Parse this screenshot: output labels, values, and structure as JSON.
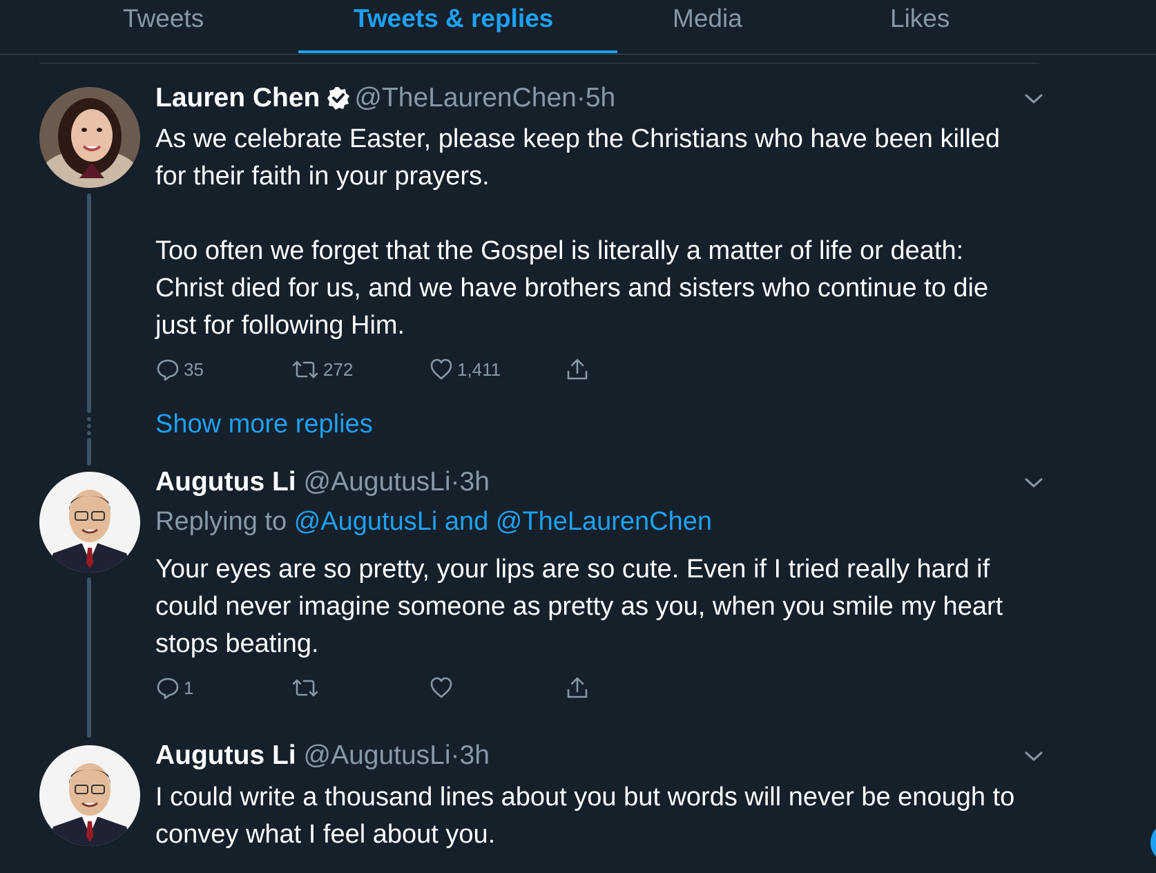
{
  "tabs": [
    {
      "label": "Tweets"
    },
    {
      "label": "Tweets & replies"
    },
    {
      "label": "Media"
    },
    {
      "label": "Likes"
    }
  ],
  "active_tab": "Tweets & replies",
  "show_more_label": "Show more replies",
  "tweets": [
    {
      "name": "Lauren Chen",
      "verified": true,
      "handle": "@TheLaurenChen",
      "separator": "·",
      "time": "5h",
      "paragraphs": [
        "As we celebrate Easter, please keep the Christians who have been killed for their faith in your prayers.",
        "Too often we forget that the Gospel is literally a matter of life or death: Christ died for us, and we have brothers and sisters who continue to die just for following Him."
      ],
      "replies": "35",
      "retweets": "272",
      "likes": "1,411"
    },
    {
      "name": "Augutus Li",
      "handle": "@AugutusLi",
      "separator": "·",
      "time": "3h",
      "replying_prefix": "Replying to",
      "replying_to": "@AugutusLi and @TheLaurenChen",
      "paragraphs": [
        "Your eyes are so pretty, your lips are so cute. Even if I tried really hard if could never imagine someone as pretty as you, when you smile my heart stops beating."
      ],
      "replies": "1",
      "retweets": "",
      "likes": ""
    },
    {
      "name": "Augutus Li",
      "handle": "@AugutusLi",
      "separator": "·",
      "time": "3h",
      "paragraphs": [
        "I could write a thousand lines about you but words will never be enough to convey what I feel about you."
      ]
    }
  ],
  "colors": {
    "background": "#15202b",
    "accent": "#1da1f2",
    "secondary_text": "#8899a6",
    "divider": "#38444d"
  },
  "icons": [
    "verified-badge-icon",
    "chevron-down-icon",
    "reply-icon",
    "retweet-icon",
    "like-icon",
    "share-icon"
  ]
}
